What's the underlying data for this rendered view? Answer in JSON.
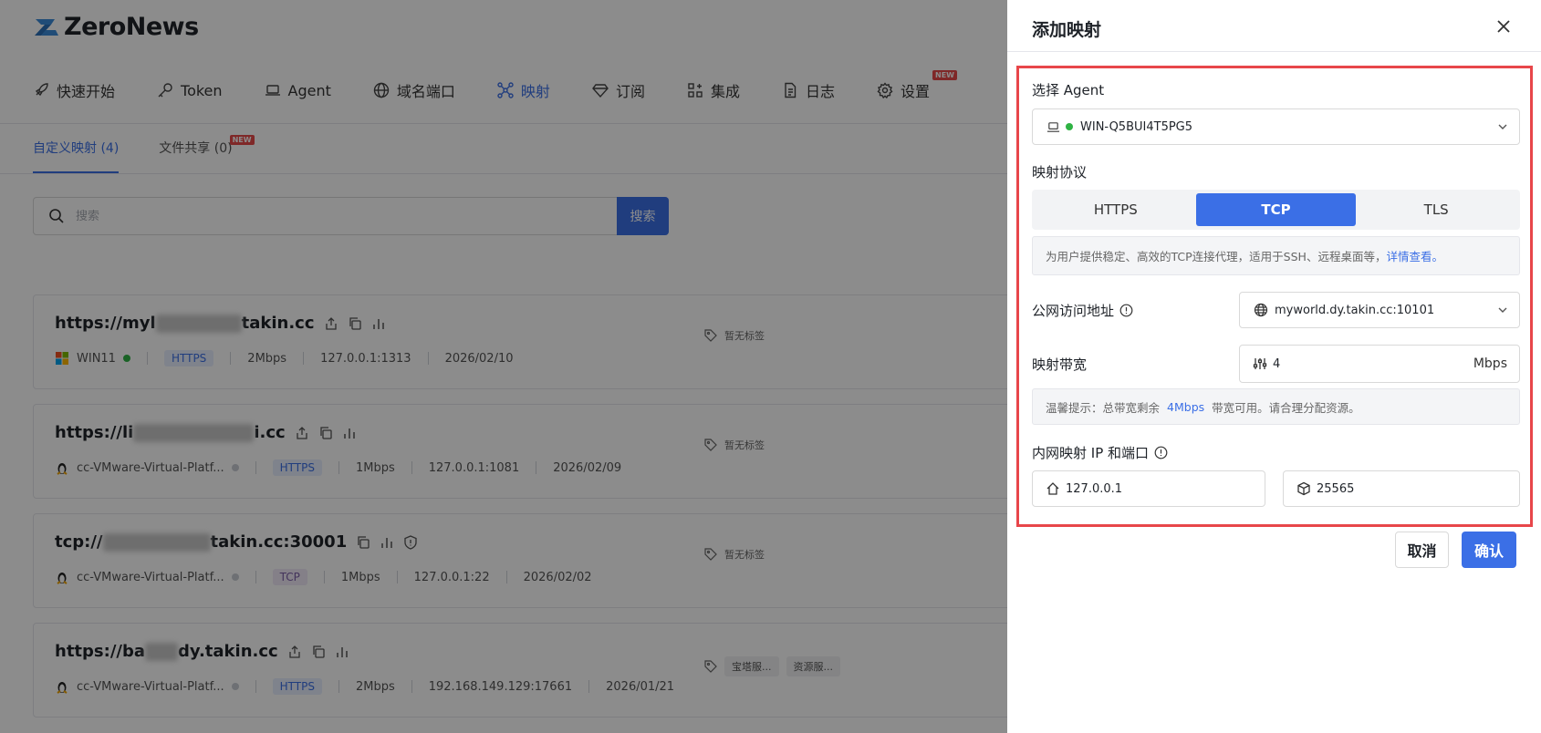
{
  "app": {
    "name": "ZeroNews"
  },
  "nav": [
    {
      "label": "快速开始",
      "icon": "rocket-icon"
    },
    {
      "label": "Token",
      "icon": "key-icon"
    },
    {
      "label": "Agent",
      "icon": "laptop-icon"
    },
    {
      "label": "域名端口",
      "icon": "globe-icon"
    },
    {
      "label": "映射",
      "icon": "mapping-icon",
      "active": true
    },
    {
      "label": "订阅",
      "icon": "diamond-icon"
    },
    {
      "label": "集成",
      "icon": "grid-plus-icon"
    },
    {
      "label": "日志",
      "icon": "document-icon"
    },
    {
      "label": "设置",
      "icon": "gear-icon",
      "badge": "NEW"
    }
  ],
  "subtabs": [
    {
      "label": "自定义映射 (4)",
      "active": true
    },
    {
      "label": "文件共享 (0)",
      "badge": "NEW"
    }
  ],
  "search": {
    "placeholder": "搜索",
    "button": "搜索"
  },
  "mappings": [
    {
      "url_prefix": "https://myl",
      "url_suffix": "takin.cc",
      "agent": "WIN11",
      "agent_online": true,
      "protocol": "HTTPS",
      "bandwidth": "2Mbps",
      "target": "127.0.0.1:1313",
      "date": "2026/02/10",
      "tags": [],
      "tags_empty": "暂无标签"
    },
    {
      "url_prefix": "https://li",
      "url_suffix": "i.cc",
      "agent": "cc-VMware-Virtual-Platf...",
      "agent_online": false,
      "protocol": "HTTPS",
      "bandwidth": "1Mbps",
      "target": "127.0.0.1:1081",
      "date": "2026/02/09",
      "tags": [],
      "tags_empty": "暂无标签"
    },
    {
      "url_prefix": "tcp://",
      "url_suffix": "takin.cc:30001",
      "agent": "cc-VMware-Virtual-Platf...",
      "agent_online": false,
      "protocol": "TCP",
      "bandwidth": "1Mbps",
      "target": "127.0.0.1:22",
      "date": "2026/02/02",
      "tags": [],
      "tags_empty": "暂无标签"
    },
    {
      "url_prefix": "https://ba",
      "url_suffix": "dy.takin.cc",
      "agent": "cc-VMware-Virtual-Platf...",
      "agent_online": false,
      "protocol": "HTTPS",
      "bandwidth": "2Mbps",
      "target": "192.168.149.129:17661",
      "date": "2026/01/21",
      "tags": [
        "宝塔服...",
        "资源服..."
      ],
      "tags_empty": ""
    }
  ],
  "drawer": {
    "title": "添加映射",
    "agent_label": "选择 Agent",
    "agent_value": "WIN-Q5BUI4T5PG5",
    "protocol_label": "映射协议",
    "protocols": [
      "HTTPS",
      "TCP",
      "TLS"
    ],
    "protocol_selected": "TCP",
    "protocol_note": "为用户提供稳定、高效的TCP连接代理，适用于SSH、远程桌面等，",
    "protocol_note_link": "详情查看。",
    "public_label": "公网访问地址",
    "public_value": "myworld.dy.takin.cc:10101",
    "bandwidth_label": "映射带宽",
    "bandwidth_value": "4",
    "bandwidth_unit": "Mbps",
    "bandwidth_tip_prefix": "温馨提示：总带宽剩余",
    "bandwidth_tip_value": "4Mbps",
    "bandwidth_tip_suffix": "带宽可用。请合理分配资源。",
    "local_label": "内网映射 IP 和端口",
    "local_ip": "127.0.0.1",
    "local_port": "25565",
    "cancel": "取消",
    "confirm": "确认"
  },
  "colors": {
    "accent": "#3b6fe6",
    "highlight": "#e8464a",
    "online": "#2fb344"
  }
}
